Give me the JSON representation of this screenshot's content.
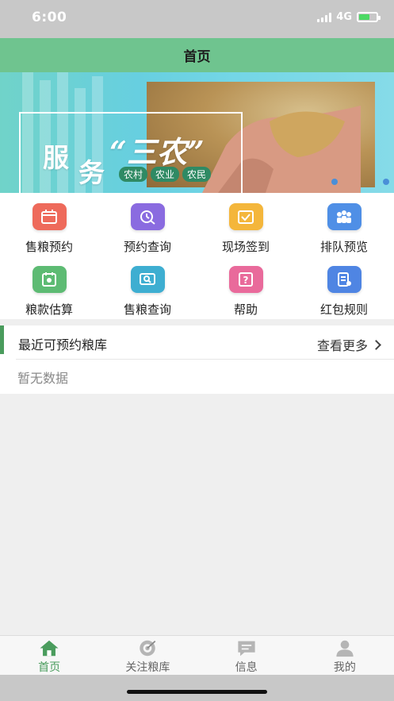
{
  "status_bar": {
    "time": "6:00",
    "network": "4G"
  },
  "nav": {
    "title": "首页"
  },
  "banner": {
    "slogan_line1": "服",
    "slogan_line2": "务",
    "slogan_quote": "“三农”",
    "tags": [
      "农村",
      "农业",
      "农民"
    ]
  },
  "grid": {
    "items": [
      {
        "label": "售粮预约",
        "icon": "calendar-icon",
        "color": "#ee6a5b"
      },
      {
        "label": "预约查询",
        "icon": "clock-search-icon",
        "color": "#8a6be0"
      },
      {
        "label": "现场签到",
        "icon": "checkin-icon",
        "color": "#f4b63b"
      },
      {
        "label": "排队预览",
        "icon": "queue-icon",
        "color": "#4f8fe6"
      },
      {
        "label": "粮款估算",
        "icon": "estimate-icon",
        "color": "#5dbb73"
      },
      {
        "label": "售粮查询",
        "icon": "search-document-icon",
        "color": "#3eaed1"
      },
      {
        "label": "帮助",
        "icon": "help-icon",
        "color": "#e96a9b"
      },
      {
        "label": "红包规则",
        "icon": "rules-icon",
        "color": "#4f85e3"
      }
    ]
  },
  "recent": {
    "title": "最近可预约粮库",
    "more": "查看更多",
    "empty": "暂无数据"
  },
  "tabs": [
    {
      "label": "首页",
      "icon": "home-icon",
      "active": true
    },
    {
      "label": "关注粮库",
      "icon": "target-icon",
      "active": false
    },
    {
      "label": "信息",
      "icon": "message-icon",
      "active": false
    },
    {
      "label": "我的",
      "icon": "user-icon",
      "active": false
    }
  ],
  "colors": {
    "accent": "#6fc48f",
    "active_tab": "#4a9c5d"
  }
}
